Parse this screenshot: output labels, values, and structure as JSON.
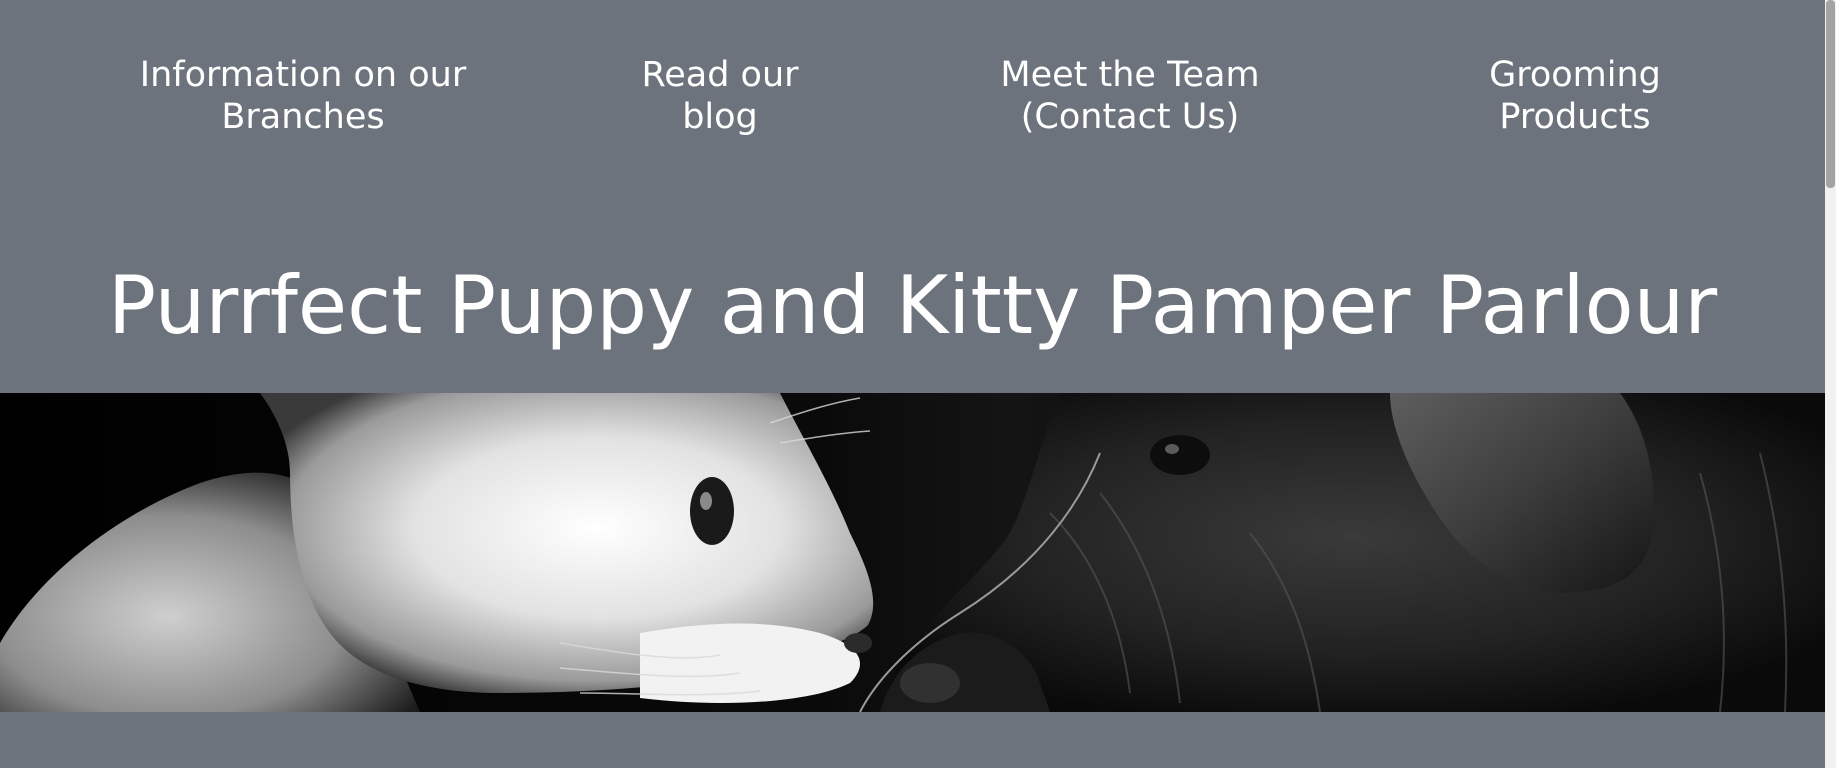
{
  "nav": {
    "items": [
      {
        "line1": "Information on our",
        "line2": "Branches"
      },
      {
        "line1": "Read our",
        "line2": "blog"
      },
      {
        "line1": "Meet the Team",
        "line2": "(Contact Us)"
      },
      {
        "line1": "Grooming",
        "line2": "Products"
      }
    ]
  },
  "header": {
    "title": "Purrfect Puppy and Kitty Pamper Parlour"
  },
  "hero": {
    "image_subject": "black-and-white photo of a white cat and a dark long-haired dog face to face"
  },
  "colors": {
    "background": "#6d737c",
    "text": "#ffffff"
  }
}
